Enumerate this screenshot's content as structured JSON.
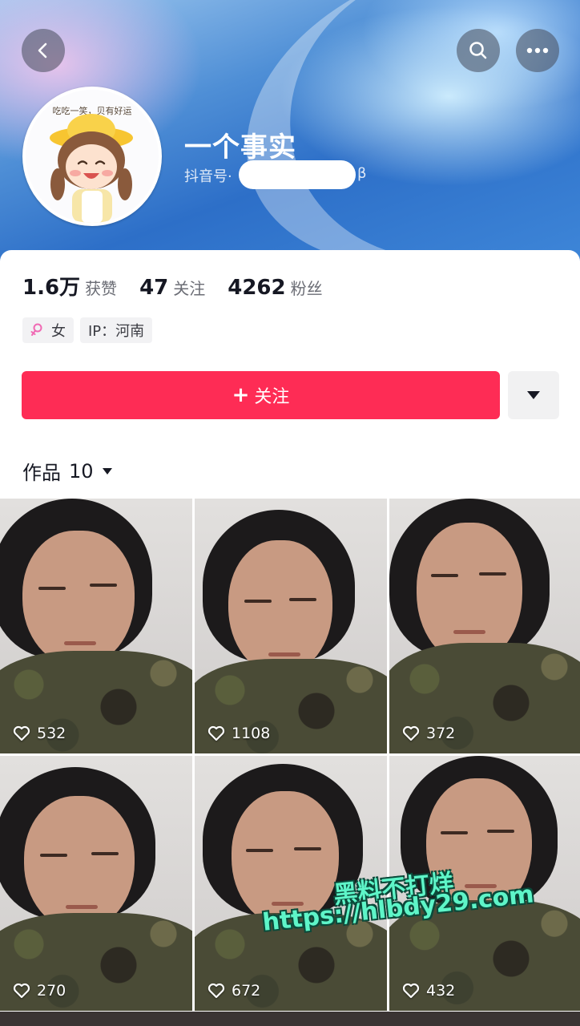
{
  "profile": {
    "name": "一个事实",
    "douyin_id_prefix": "抖音号·",
    "douyin_id_suffix": "β",
    "avatar_caption": "吃吃一笑，贝有好运"
  },
  "stats": [
    {
      "value": "1.6万",
      "label": "获赞"
    },
    {
      "value": "47",
      "label": "关注"
    },
    {
      "value": "4262",
      "label": "粉丝"
    }
  ],
  "tags": {
    "gender": "女",
    "ip": "IP：河南"
  },
  "actions": {
    "follow_plus": "+",
    "follow_label": "关注"
  },
  "works": {
    "label": "作品",
    "count": "10"
  },
  "videos": [
    {
      "likes": "532"
    },
    {
      "likes": "1108"
    },
    {
      "likes": "372"
    },
    {
      "likes": "270"
    },
    {
      "likes": "672"
    },
    {
      "likes": "432"
    }
  ],
  "watermark": {
    "line1": "黑料不打烊",
    "line2": "https://hlbdy29.com"
  },
  "icons": {
    "back": "chevron-left-icon",
    "search": "search-icon",
    "more": "more-icon",
    "heart": "heart-icon",
    "gender": "female-icon",
    "dropdown": "caret-down-icon"
  },
  "colors": {
    "accent": "#fe2c55",
    "watermark": "#5ef5c8"
  }
}
